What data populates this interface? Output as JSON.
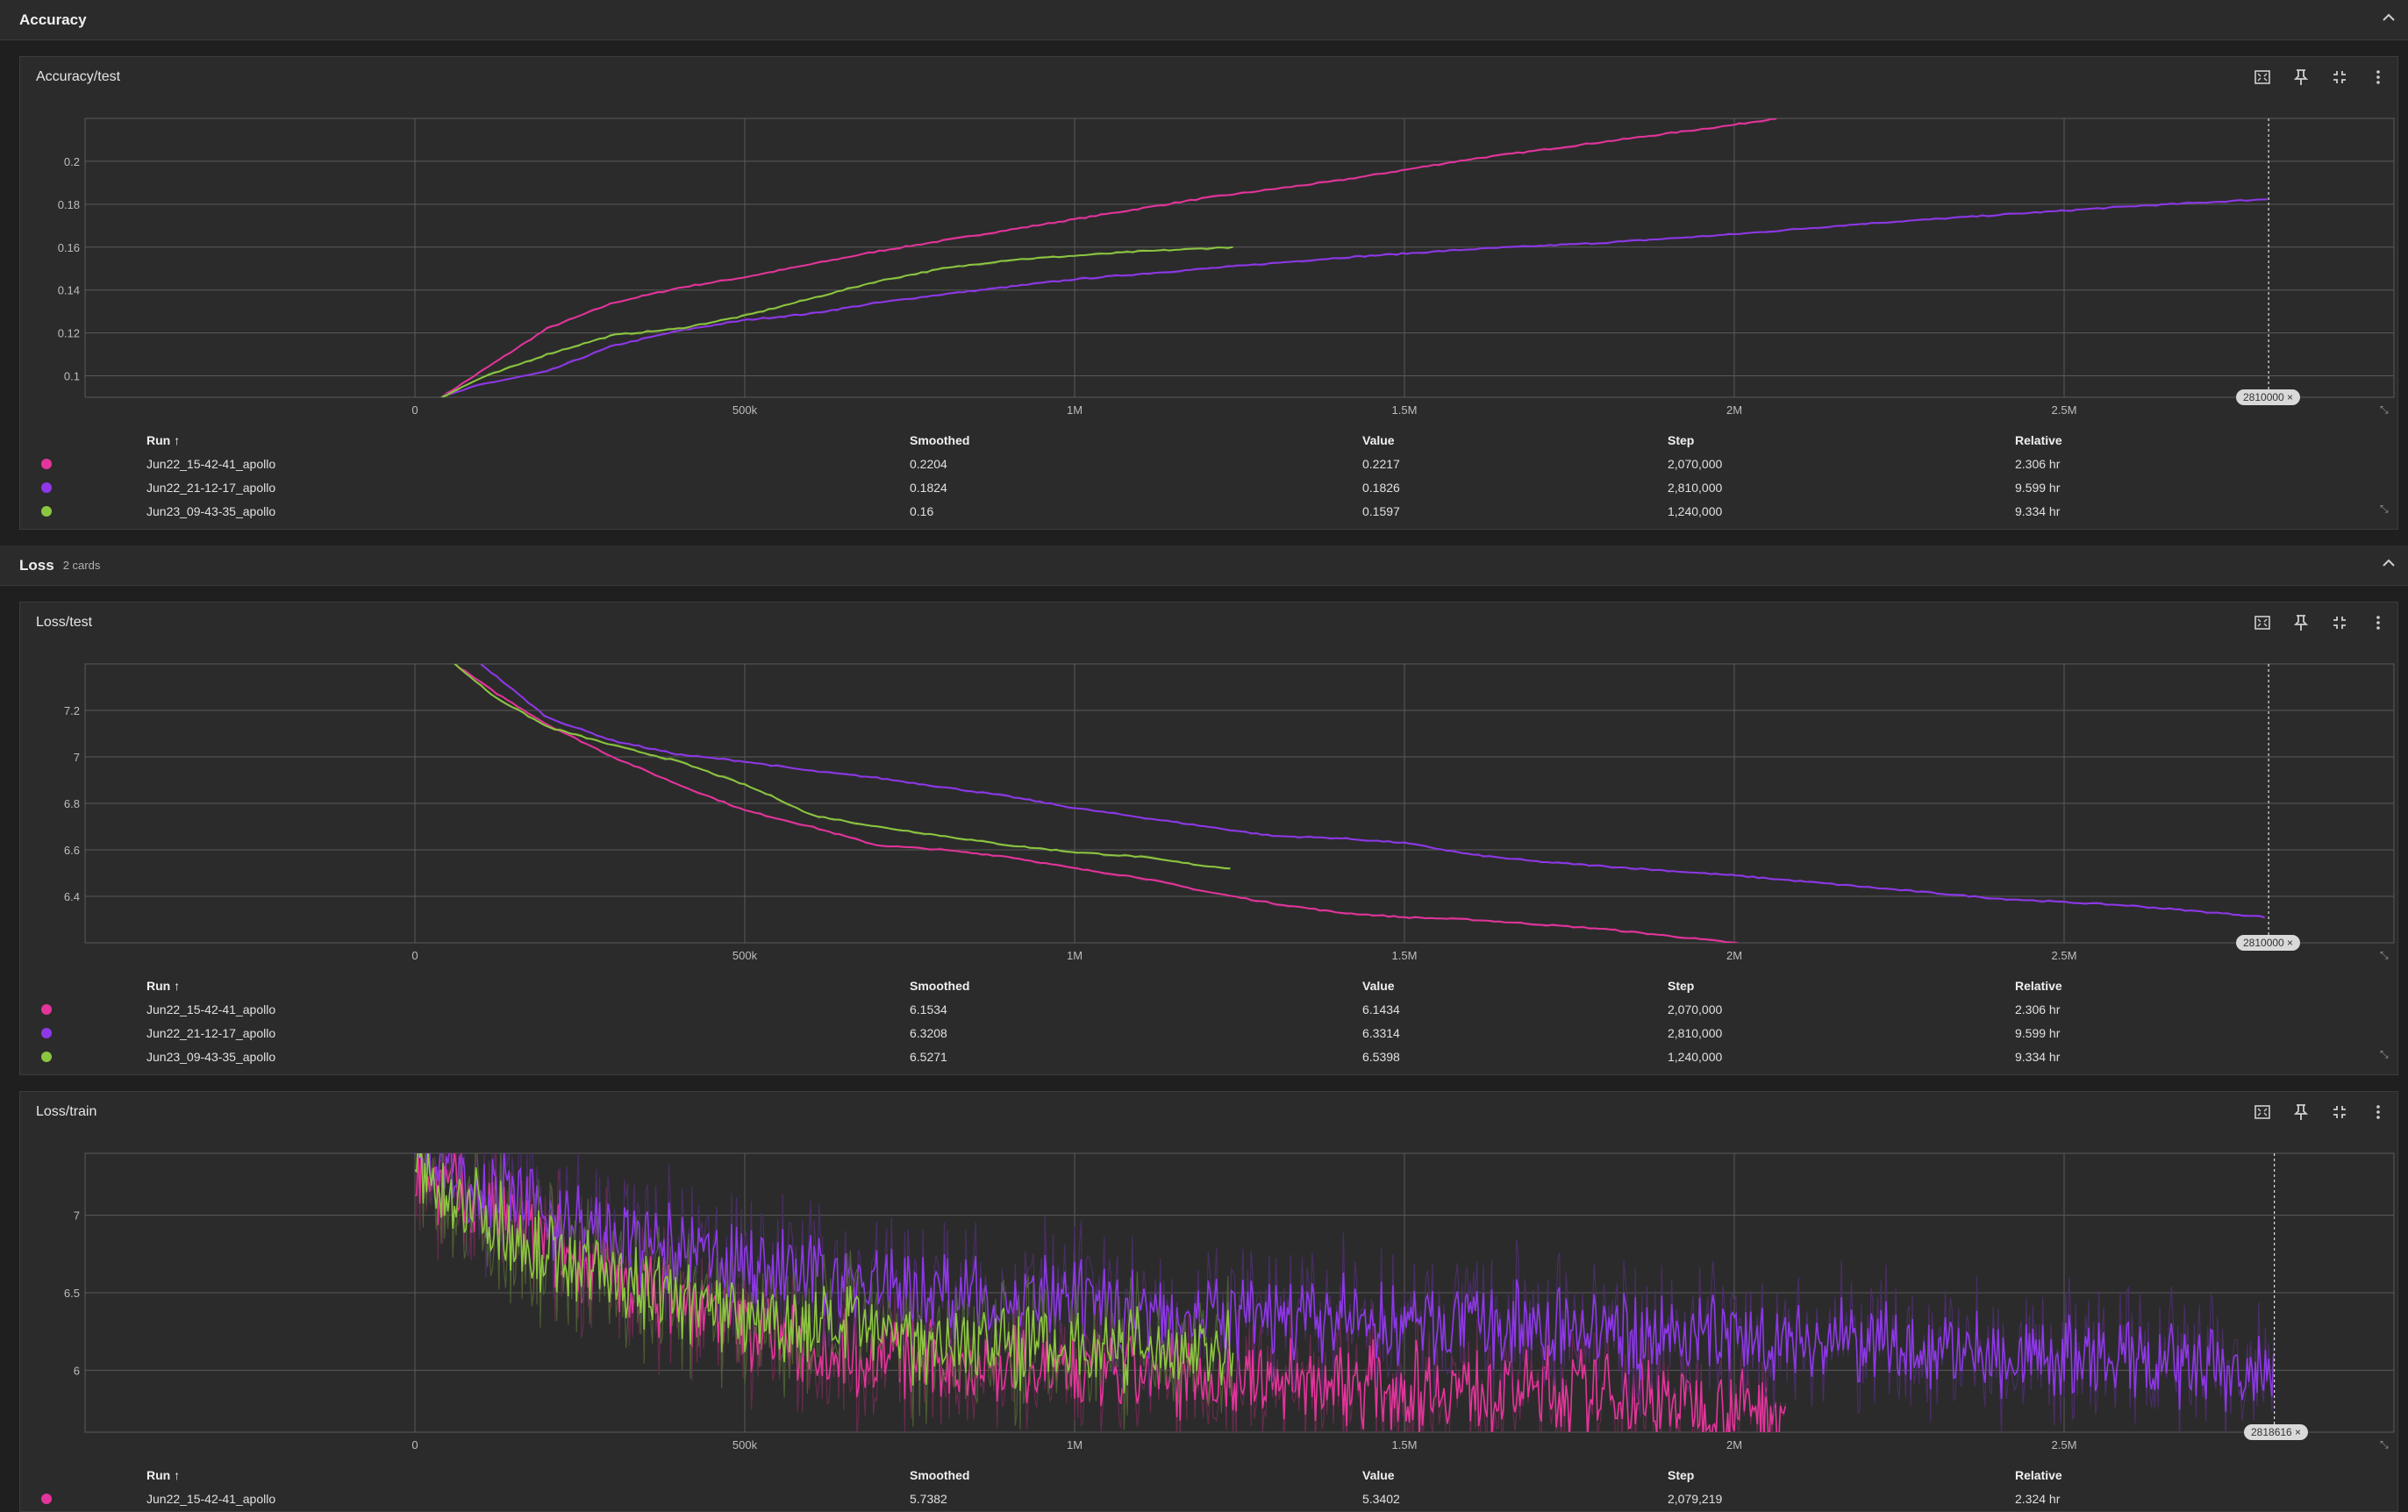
{
  "groups": {
    "accuracy": {
      "title": "Accuracy",
      "count": ""
    },
    "loss": {
      "title": "Loss",
      "count": "2 cards"
    }
  },
  "toolbar_icons": [
    "fit-domain-icon",
    "pin-icon",
    "collapse-icon",
    "more-vert-icon"
  ],
  "table_headers": {
    "run": "Run ↑",
    "smoothed": "Smoothed",
    "value": "Value",
    "step": "Step",
    "relative": "Relative"
  },
  "colors": {
    "run_pink": "#e3359b",
    "run_purple": "#8e38e8",
    "run_green": "#8cc640",
    "raw_pink": "#6b2a50",
    "raw_purple": "#4d2d6b",
    "raw_green": "#4f6233",
    "grid": "#5a5a5a",
    "plot_bg": "#2b2b2b"
  },
  "cards": [
    {
      "id": "acc_test",
      "title": "Accuracy/test",
      "cursor_step": "2810000",
      "rows": [
        {
          "color": "#e3359b",
          "run": "Jun22_15-42-41_apollo",
          "smoothed": "0.2204",
          "value": "0.2217",
          "step": "2,070,000",
          "relative": "2.306 hr"
        },
        {
          "color": "#8e38e8",
          "run": "Jun22_21-12-17_apollo",
          "smoothed": "0.1824",
          "value": "0.1826",
          "step": "2,810,000",
          "relative": "9.599 hr"
        },
        {
          "color": "#8cc640",
          "run": "Jun23_09-43-35_apollo",
          "smoothed": "0.16",
          "value": "0.1597",
          "step": "1,240,000",
          "relative": "9.334 hr"
        }
      ]
    },
    {
      "id": "loss_test",
      "title": "Loss/test",
      "cursor_step": "2810000",
      "rows": [
        {
          "color": "#e3359b",
          "run": "Jun22_15-42-41_apollo",
          "smoothed": "6.1534",
          "value": "6.1434",
          "step": "2,070,000",
          "relative": "2.306 hr"
        },
        {
          "color": "#8e38e8",
          "run": "Jun22_21-12-17_apollo",
          "smoothed": "6.3208",
          "value": "6.3314",
          "step": "2,810,000",
          "relative": "9.599 hr"
        },
        {
          "color": "#8cc640",
          "run": "Jun23_09-43-35_apollo",
          "smoothed": "6.5271",
          "value": "6.5398",
          "step": "1,240,000",
          "relative": "9.334 hr"
        }
      ]
    },
    {
      "id": "loss_train",
      "title": "Loss/train",
      "cursor_step": "2818616",
      "rows": [
        {
          "color": "#e3359b",
          "run": "Jun22_15-42-41_apollo",
          "smoothed": "5.7382",
          "value": "5.3402",
          "step": "2,079,219",
          "relative": "2.324 hr"
        }
      ]
    }
  ],
  "chart_data": [
    {
      "type": "line",
      "title": "Accuracy/test",
      "xlim": [
        -500000,
        3000000
      ],
      "ylim": [
        0.09,
        0.22
      ],
      "x_ticks": [
        {
          "v": 0,
          "label": "0"
        },
        {
          "v": 500000,
          "label": "500k"
        },
        {
          "v": 1000000,
          "label": "1M"
        },
        {
          "v": 1500000,
          "label": "1.5M"
        },
        {
          "v": 2000000,
          "label": "2M"
        },
        {
          "v": 2500000,
          "label": "2.5M"
        }
      ],
      "y_ticks": [
        {
          "v": 0.1,
          "label": "0.1"
        },
        {
          "v": 0.12,
          "label": "0.12"
        },
        {
          "v": 0.14,
          "label": "0.14"
        },
        {
          "v": 0.16,
          "label": "0.16"
        },
        {
          "v": 0.18,
          "label": "0.18"
        },
        {
          "v": 0.2,
          "label": "0.2"
        }
      ],
      "grid": true,
      "cursor_x": 2810000,
      "series": [
        {
          "name": "Jun22_15-42-41_apollo",
          "color": "#e3359b",
          "x": [
            40000,
            100000,
            200000,
            300000,
            400000,
            500000,
            600000,
            700000,
            800000,
            900000,
            1000000,
            1100000,
            1200000,
            1300000,
            1400000,
            1500000,
            1600000,
            1700000,
            1800000,
            1900000,
            2000000,
            2070000
          ],
          "y": [
            0.09,
            0.102,
            0.122,
            0.134,
            0.141,
            0.146,
            0.152,
            0.158,
            0.163,
            0.168,
            0.173,
            0.178,
            0.183,
            0.187,
            0.191,
            0.196,
            0.201,
            0.205,
            0.209,
            0.213,
            0.217,
            0.2204
          ]
        },
        {
          "name": "Jun22_21-12-17_apollo",
          "color": "#8e38e8",
          "x": [
            40000,
            100000,
            200000,
            300000,
            400000,
            500000,
            600000,
            700000,
            800000,
            1000000,
            1200000,
            1400000,
            1600000,
            1800000,
            2000000,
            2200000,
            2400000,
            2600000,
            2810000
          ],
          "y": [
            0.09,
            0.096,
            0.102,
            0.114,
            0.121,
            0.126,
            0.129,
            0.134,
            0.138,
            0.145,
            0.15,
            0.155,
            0.159,
            0.162,
            0.166,
            0.171,
            0.175,
            0.179,
            0.1824
          ]
        },
        {
          "name": "Jun23_09-43-35_apollo",
          "color": "#8cc640",
          "x": [
            40000,
            100000,
            200000,
            300000,
            400000,
            500000,
            600000,
            700000,
            800000,
            900000,
            1000000,
            1100000,
            1240000
          ],
          "y": [
            0.09,
            0.099,
            0.11,
            0.119,
            0.122,
            0.128,
            0.136,
            0.144,
            0.15,
            0.154,
            0.156,
            0.158,
            0.16
          ]
        }
      ]
    },
    {
      "type": "line",
      "title": "Loss/test",
      "xlim": [
        -500000,
        3000000
      ],
      "ylim": [
        6.2,
        7.4
      ],
      "x_ticks": [
        {
          "v": 0,
          "label": "0"
        },
        {
          "v": 500000,
          "label": "500k"
        },
        {
          "v": 1000000,
          "label": "1M"
        },
        {
          "v": 1500000,
          "label": "1.5M"
        },
        {
          "v": 2000000,
          "label": "2M"
        },
        {
          "v": 2500000,
          "label": "2.5M"
        }
      ],
      "y_ticks": [
        {
          "v": 6.4,
          "label": "6.4"
        },
        {
          "v": 6.6,
          "label": "6.6"
        },
        {
          "v": 6.8,
          "label": "6.8"
        },
        {
          "v": 7,
          "label": "7"
        },
        {
          "v": 7.2,
          "label": "7.2"
        }
      ],
      "grid": true,
      "cursor_x": 2810000,
      "series": [
        {
          "name": "Jun22_15-42-41_apollo",
          "color": "#e3359b",
          "x": [
            60000,
            120000,
            200000,
            300000,
            400000,
            500000,
            600000,
            700000,
            800000,
            900000,
            1000000,
            1100000,
            1200000,
            1300000,
            1400000,
            1500000,
            1600000,
            1700000,
            1800000,
            1900000,
            2000000,
            2070000
          ],
          "y": [
            7.4,
            7.28,
            7.14,
            7.0,
            6.88,
            6.77,
            6.7,
            6.62,
            6.6,
            6.57,
            6.52,
            6.48,
            6.42,
            6.37,
            6.33,
            6.31,
            6.3,
            6.28,
            6.26,
            6.23,
            6.2,
            6.16
          ]
        },
        {
          "name": "Jun22_21-12-17_apollo",
          "color": "#8e38e8",
          "x": [
            100000,
            200000,
            300000,
            400000,
            500000,
            600000,
            700000,
            800000,
            900000,
            1000000,
            1100000,
            1200000,
            1300000,
            1400000,
            1500000,
            1600000,
            1700000,
            1800000,
            1900000,
            2000000,
            2200000,
            2400000,
            2600000,
            2810000
          ],
          "y": [
            7.4,
            7.17,
            7.07,
            7.01,
            6.98,
            6.94,
            6.91,
            6.87,
            6.83,
            6.78,
            6.74,
            6.7,
            6.66,
            6.65,
            6.63,
            6.58,
            6.55,
            6.53,
            6.51,
            6.49,
            6.44,
            6.39,
            6.36,
            6.31
          ]
        },
        {
          "name": "Jun23_09-43-35_apollo",
          "color": "#8cc640",
          "x": [
            60000,
            120000,
            200000,
            300000,
            400000,
            500000,
            550000,
            600000,
            700000,
            800000,
            900000,
            1000000,
            1100000,
            1200000,
            1240000
          ],
          "y": [
            7.4,
            7.26,
            7.13,
            7.05,
            6.98,
            6.88,
            6.82,
            6.75,
            6.7,
            6.66,
            6.62,
            6.59,
            6.57,
            6.53,
            6.52
          ]
        }
      ]
    },
    {
      "type": "line",
      "title": "Loss/train",
      "xlim": [
        -500000,
        3000000
      ],
      "ylim": [
        5.6,
        7.4
      ],
      "x_ticks": [
        {
          "v": 0,
          "label": "0"
        },
        {
          "v": 500000,
          "label": "500k"
        },
        {
          "v": 1000000,
          "label": "1M"
        },
        {
          "v": 1500000,
          "label": "1.5M"
        },
        {
          "v": 2000000,
          "label": "2M"
        },
        {
          "v": 2500000,
          "label": "2.5M"
        }
      ],
      "y_ticks": [
        {
          "v": 6,
          "label": "6"
        },
        {
          "v": 6.5,
          "label": "6.5"
        },
        {
          "v": 7,
          "label": "7"
        }
      ],
      "grid": true,
      "cursor_x": 2818616,
      "noisy": true,
      "series": [
        {
          "name": "Jun22_15-42-41_apollo",
          "color": "#e3359b",
          "x": [
            0,
            300000,
            600000,
            900000,
            1200000,
            1500000,
            1800000,
            2079219
          ],
          "y": [
            7.3,
            6.6,
            6.15,
            6.0,
            5.95,
            5.9,
            5.85,
            5.74
          ]
        },
        {
          "name": "Jun22_21-12-17_apollo",
          "color": "#8e38e8",
          "x": [
            0,
            300000,
            600000,
            900000,
            1200000,
            1500000,
            1800000,
            2100000,
            2400000,
            2700000,
            2818616
          ],
          "y": [
            7.35,
            6.85,
            6.6,
            6.45,
            6.35,
            6.3,
            6.25,
            6.2,
            6.1,
            6.0,
            5.95
          ]
        },
        {
          "name": "Jun23_09-43-35_apollo",
          "color": "#8cc640",
          "x": [
            0,
            200000,
            400000,
            600000,
            800000,
            1000000,
            1240000
          ],
          "y": [
            7.3,
            6.75,
            6.45,
            6.3,
            6.2,
            6.15,
            6.12
          ]
        }
      ]
    }
  ]
}
